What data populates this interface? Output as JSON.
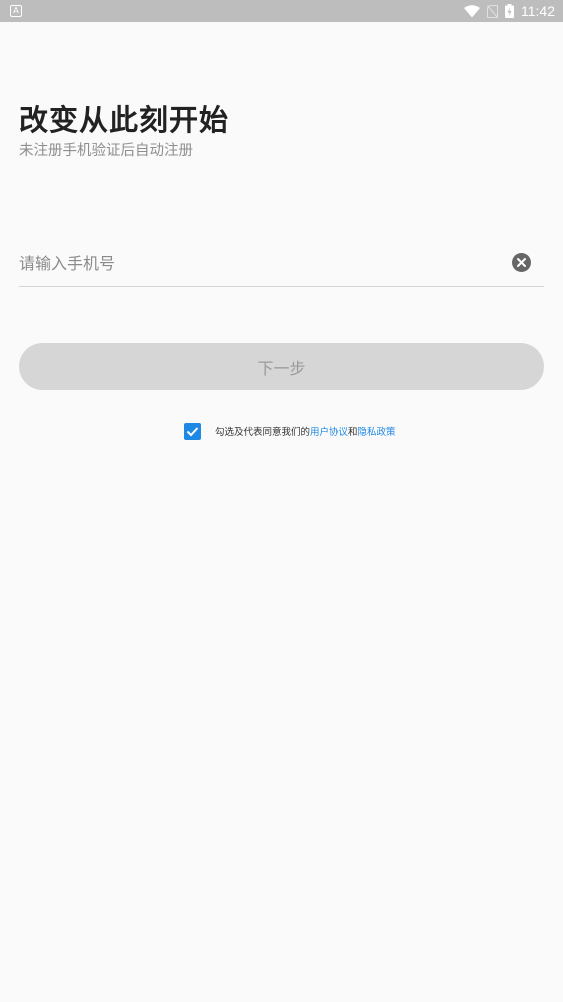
{
  "status_bar": {
    "time": "11:42",
    "icons": [
      "app-notification-icon",
      "wifi-icon",
      "no-sim-icon",
      "battery-charging-icon"
    ]
  },
  "header": {
    "title": "改变从此刻开始",
    "subtitle": "未注册手机验证后自动注册"
  },
  "phone_field": {
    "placeholder": "请输入手机号",
    "value": ""
  },
  "next_button": {
    "label": "下一步"
  },
  "agreement": {
    "checked": true,
    "prefix": "勾选及代表同意我们的",
    "user_agreement": "用户协议",
    "conjunction": "和",
    "privacy_policy": "隐私政策"
  },
  "colors": {
    "accent": "#1e88e5",
    "status_bar": "#bdbdbd",
    "background": "#fafafa",
    "button_disabled": "#d6d6d6"
  }
}
